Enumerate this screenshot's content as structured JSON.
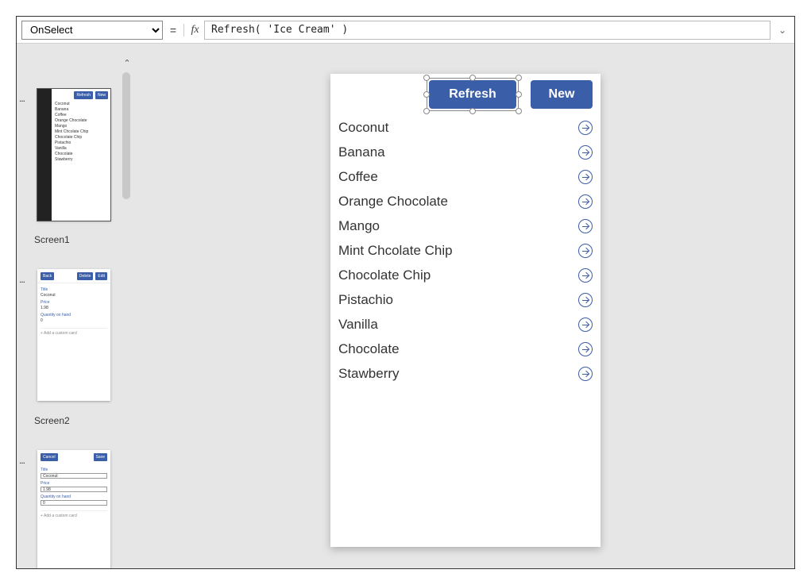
{
  "formula": {
    "property": "OnSelect",
    "equals": "=",
    "fx": "fx",
    "expression": "Refresh( 'Ice Cream' )",
    "caret": "⌄"
  },
  "rail": {
    "scroll_up": "⌃",
    "screen1": {
      "label": "Screen1",
      "dots": "...",
      "refresh": "Refresh",
      "new": "New",
      "items": [
        "Coconut",
        "Banana",
        "Coffee",
        "Orange Chocolate",
        "Mango",
        "Mint Chcolate Chip",
        "Chocolate Chip",
        "Pistachio",
        "Vanilla",
        "Chocolate",
        "Stawberry"
      ]
    },
    "screen2": {
      "label": "Screen2",
      "dots": "...",
      "back": "Back",
      "delete": "Delete",
      "edit": "Edit",
      "title_lbl": "Title",
      "title_val": "Coconut",
      "price_lbl": "Price",
      "price_val": "1.98",
      "qty_lbl": "Quantity on hand",
      "qty_val": "0",
      "add": "+  Add a custom card"
    },
    "screen3": {
      "dots": "...",
      "cancel": "Cancel",
      "save": "Save",
      "title_lbl": "Title",
      "title_val": "Coconut",
      "price_lbl": "Price",
      "price_val": "1.98",
      "qty_lbl": "Quantity on hand",
      "qty_val": "0",
      "add": "+  Add a custom card"
    }
  },
  "app": {
    "refresh": "Refresh",
    "new": "New",
    "items": [
      "Coconut",
      "Banana",
      "Coffee",
      "Orange Chocolate",
      "Mango",
      "Mint Chcolate Chip",
      "Chocolate Chip",
      "Pistachio",
      "Vanilla",
      "Chocolate",
      "Stawberry"
    ]
  }
}
